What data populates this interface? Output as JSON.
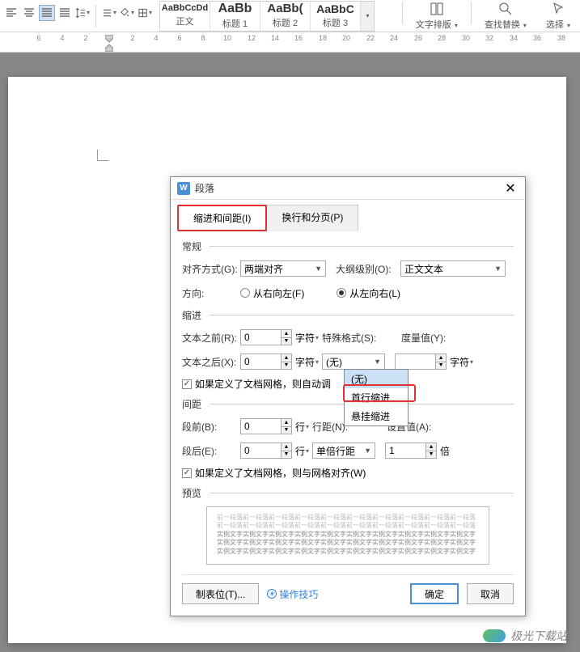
{
  "ribbon": {
    "styles": [
      {
        "preview": "AaBbCcDd",
        "name": "正文"
      },
      {
        "preview": "AaBb",
        "name": "标题 1"
      },
      {
        "preview": "AaBb(",
        "name": "标题 2"
      },
      {
        "preview": "AaBbC",
        "name": "标题 3"
      }
    ],
    "layout_label": "文字排版",
    "find_replace_label": "查找替换",
    "select_label": "选择"
  },
  "ruler": {
    "numbers": [
      6,
      4,
      2,
      2,
      4,
      6,
      8,
      10,
      12,
      14,
      16,
      18,
      20,
      22,
      24,
      26,
      28,
      30,
      32,
      34,
      36,
      38
    ]
  },
  "dialog": {
    "title": "段落",
    "tabs": {
      "indent": "缩进和间距(I)",
      "pagination": "换行和分页(P)"
    },
    "general": {
      "label": "常规",
      "alignment_label": "对齐方式(G):",
      "alignment_value": "两端对齐",
      "outline_label": "大纲级别(O):",
      "outline_value": "正文文本",
      "direction_label": "方向:",
      "rtl_label": "从右向左(F)",
      "ltr_label": "从左向右(L)"
    },
    "indent": {
      "label": "缩进",
      "before_label": "文本之前(R):",
      "before_value": "0",
      "after_label": "文本之后(X):",
      "after_value": "0",
      "unit": "字符",
      "special_label": "特殊格式(S):",
      "special_value": "(无)",
      "measure_label": "度量值(Y):",
      "measure_value": "",
      "dropdown_items": [
        "(无)",
        "首行缩进",
        "悬挂缩进"
      ],
      "checkbox_label": "如果定义了文档网格，则自动调"
    },
    "spacing": {
      "label": "间距",
      "before_label": "段前(B):",
      "before_value": "0",
      "after_label": "段后(E):",
      "after_value": "0",
      "unit": "行",
      "line_label": "行距(N):",
      "line_value": "单倍行距",
      "setat_label": "设置值(A):",
      "setat_value": "1",
      "setat_unit": "倍",
      "checkbox_label": "如果定义了文档网格，则与网格对齐(W)"
    },
    "preview": {
      "label": "预览",
      "placeholder": "前一段落前一段落前一段落前一段落前一段落前一段落前一段落前一段落前一段落前一段落\n前一段落前一段落前一段落前一段落前一段落前一段落前一段落前一段落前一段落前一段落",
      "sample": "实例文字实例文字实例文字实例文字实例文字实例文字实例文字实例文字实例文字实例文字\n实例文字实例文字实例文字实例文字实例文字实例文字实例文字实例文字实例文字实例文字\n实例文字实例文字实例文字实例文字实例文字实例文字实例文字实例文字实例文字实例文字"
    },
    "buttons": {
      "tabs": "制表位(T)...",
      "tips": "操作技巧",
      "ok": "确定",
      "cancel": "取消"
    }
  },
  "watermark": "极光下载站"
}
